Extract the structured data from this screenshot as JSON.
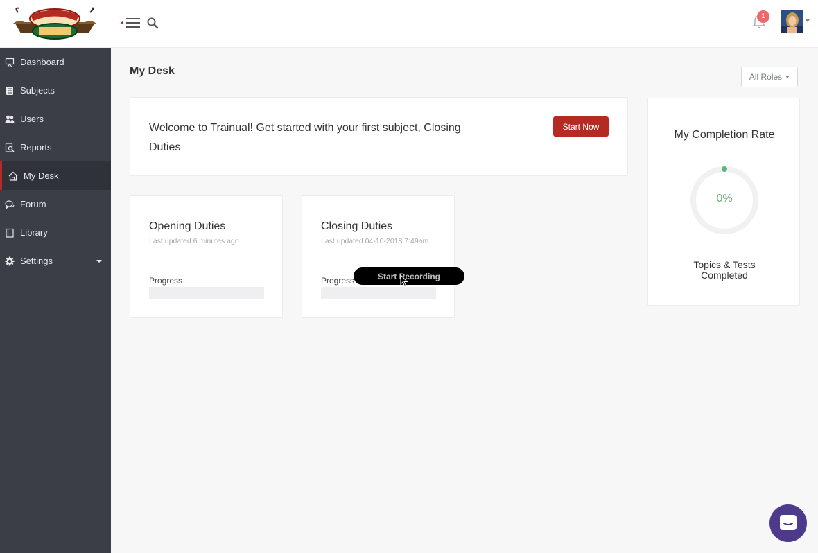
{
  "header": {
    "notification_count": "1",
    "colors": {
      "badge": "#f0676a"
    }
  },
  "sidebar": {
    "items": [
      {
        "label": "Dashboard",
        "icon": "presentation-icon"
      },
      {
        "label": "Subjects",
        "icon": "book-icon"
      },
      {
        "label": "Users",
        "icon": "users-icon"
      },
      {
        "label": "Reports",
        "icon": "report-icon"
      },
      {
        "label": "My Desk",
        "icon": "home-icon",
        "active": true
      },
      {
        "label": "Forum",
        "icon": "chat-bubbles-icon"
      },
      {
        "label": "Library",
        "icon": "library-icon"
      },
      {
        "label": "Settings",
        "icon": "gear-icon",
        "has_dropdown": true
      }
    ],
    "colors": {
      "background": "#3b3e46",
      "active_accent": "#b52a22"
    }
  },
  "main": {
    "title": "My Desk",
    "roles_filter": {
      "selected": "All Roles"
    },
    "welcome": {
      "text": "Welcome to Trainual! Get started with your first subject, Closing Duties",
      "button_label": "Start Now"
    },
    "subjects": [
      {
        "title": "Opening Duties",
        "updated": "Last updated 6 minutes ago",
        "progress_label": "Progress",
        "progress": 0
      },
      {
        "title": "Closing Duties",
        "updated": "Last updated 04-10-2018 7:49am",
        "progress_label": "Progress",
        "progress": 0
      }
    ],
    "completion": {
      "title": "My Completion Rate",
      "value": "0%",
      "caption": "Topics & Tests Completed"
    }
  },
  "overlay": {
    "recording_label": "Start Recording"
  },
  "colors": {
    "primary": "#b52a22",
    "success": "#6bb27d",
    "chat": "#4d3a8c"
  }
}
